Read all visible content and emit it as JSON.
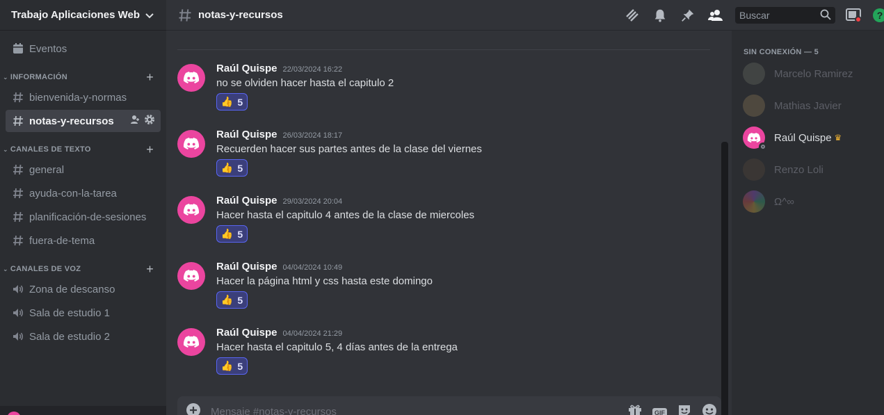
{
  "server": {
    "name": "Trabajo Aplicaciones Web"
  },
  "sidebar": {
    "events_label": "Eventos",
    "categories": [
      {
        "name": "INFORMACIÓN",
        "channels": [
          "bienvenida-y-normas",
          "notas-y-recursos"
        ]
      },
      {
        "name": "CANALES DE TEXTO",
        "channels": [
          "general",
          "ayuda-con-la-tarea",
          "planificación-de-sesiones",
          "fuera-de-tema"
        ]
      },
      {
        "name": "CANALES DE VOZ",
        "channels": [
          "Zona de descanso",
          "Sala de estudio 1",
          "Sala de estudio 2"
        ]
      }
    ],
    "active_channel": "notas-y-recursos"
  },
  "header": {
    "channel": "notas-y-recursos",
    "search_placeholder": "Buscar"
  },
  "messages": [
    {
      "author": "Raúl Quispe",
      "time": "22/03/2024 16:22",
      "text": "no se olviden hacer hasta el capitulo 2",
      "reaction_emoji": "👍",
      "reaction_count": "5"
    },
    {
      "author": "Raúl Quispe",
      "time": "26/03/2024 18:17",
      "text": "Recuerden hacer sus partes antes de la clase del viernes",
      "reaction_emoji": "👍",
      "reaction_count": "5"
    },
    {
      "author": "Raúl Quispe",
      "time": "29/03/2024 20:04",
      "text": "Hacer hasta el capitulo 4 antes de la clase de miercoles",
      "reaction_emoji": "👍",
      "reaction_count": "5"
    },
    {
      "author": "Raúl Quispe",
      "time": "04/04/2024 10:49",
      "text": "Hacer la página html y css hasta este domingo",
      "reaction_emoji": "👍",
      "reaction_count": "5"
    },
    {
      "author": "Raúl Quispe",
      "time": "04/04/2024 21:29",
      "text": "Hacer hasta el capitulo 5, 4 días antes de la entrega",
      "reaction_emoji": "👍",
      "reaction_count": "5"
    }
  ],
  "composer": {
    "placeholder": "Mensaje #notas-y-recursos",
    "gif_label": "GIF"
  },
  "members": {
    "header": "SIN CONEXIÓN — 5",
    "list": [
      {
        "name": "Marcelo Ramirez",
        "avatar_color": "#6b6f63"
      },
      {
        "name": "Mathias Javier",
        "avatar_color": "#7a6a4f"
      },
      {
        "name": "Raúl Quispe",
        "avatar_color": "#eb459f"
      },
      {
        "name": "Renzo Loli",
        "avatar_color": "#4a4038"
      },
      {
        "name": "Ω^∞",
        "avatar_color": "#5a4a7a"
      }
    ]
  },
  "colors": {
    "brand_pink": "#eb459f",
    "accent": "#5865f2",
    "online_green": "#23a55a"
  }
}
